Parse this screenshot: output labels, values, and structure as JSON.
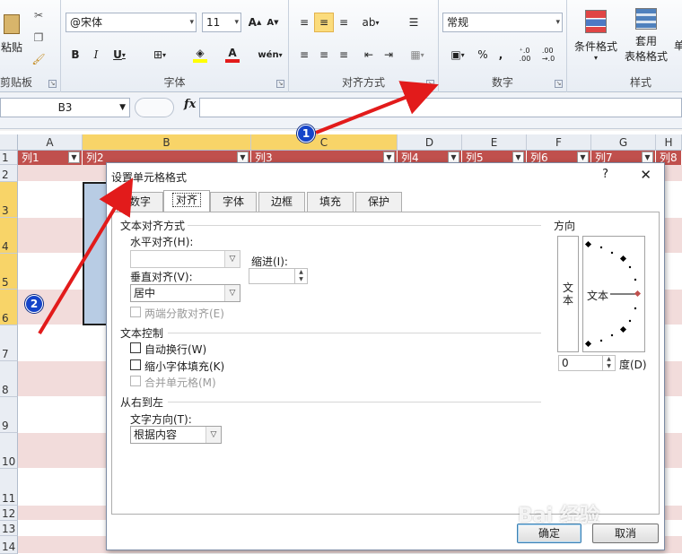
{
  "ribbon": {
    "clipboard": {
      "paste_label": "粘贴",
      "group_label": "剪贴板"
    },
    "font": {
      "font_name": "@宋体",
      "font_size": "11",
      "group_label": "字体"
    },
    "alignment": {
      "group_label": "对齐方式"
    },
    "number": {
      "format": "常规",
      "percent": "%",
      "comma": ",",
      "group_label": "数字"
    },
    "styles": {
      "conditional_label": "条件格式",
      "table_format_label1": "套用",
      "table_format_label2": "表格格式",
      "cell_label": "单",
      "group_label": "样式"
    }
  },
  "formula_bar": {
    "name_box": "B3",
    "fx": "fx",
    "content": ""
  },
  "grid": {
    "columns": [
      "A",
      "B",
      "C",
      "D",
      "E",
      "F",
      "G",
      "H"
    ],
    "table_headers": [
      "列1",
      "列2",
      "列3",
      "列4",
      "列5",
      "列6",
      "列7",
      "列8"
    ],
    "rows": [
      "1",
      "2",
      "3",
      "4",
      "5",
      "6",
      "7",
      "8",
      "9",
      "10",
      "11",
      "12",
      "13",
      "14"
    ]
  },
  "dialog": {
    "title": "设置单元格格式",
    "help": "?",
    "close": "✕",
    "tabs": [
      "数字",
      "对齐",
      "字体",
      "边框",
      "填充",
      "保护"
    ],
    "active_tab": "对齐",
    "text_alignment": {
      "title": "文本对齐方式",
      "horizontal_label": "水平对齐(H):",
      "horizontal_value": "",
      "indent_label": "缩进(I):",
      "indent_value": "",
      "vertical_label": "垂直对齐(V):",
      "vertical_value": "居中",
      "distributed_label": "两端分散对齐(E)"
    },
    "text_control": {
      "title": "文本控制",
      "wrap_label": "自动换行(W)",
      "shrink_label": "缩小字体填充(K)",
      "merge_label": "合并单元格(M)"
    },
    "rtl": {
      "title": "从右到左",
      "direction_label": "文字方向(T):",
      "direction_value": "根据内容"
    },
    "orientation": {
      "title": "方向",
      "vertical_text_1": "文",
      "vertical_text_2": "本",
      "dial_text": "文本",
      "degree_value": "0",
      "degree_label": "度(D)"
    },
    "ok_label": "确定",
    "cancel_label": "取消"
  },
  "annotations": {
    "marker1": "1",
    "marker2": "2",
    "watermark": "Bai 经验"
  },
  "colors": {
    "table_header": "#c0504d",
    "band_light": "#f2dcdb",
    "selection": "#b8cce4",
    "marker": "#1544c9",
    "arrow": "#e21b1b"
  }
}
